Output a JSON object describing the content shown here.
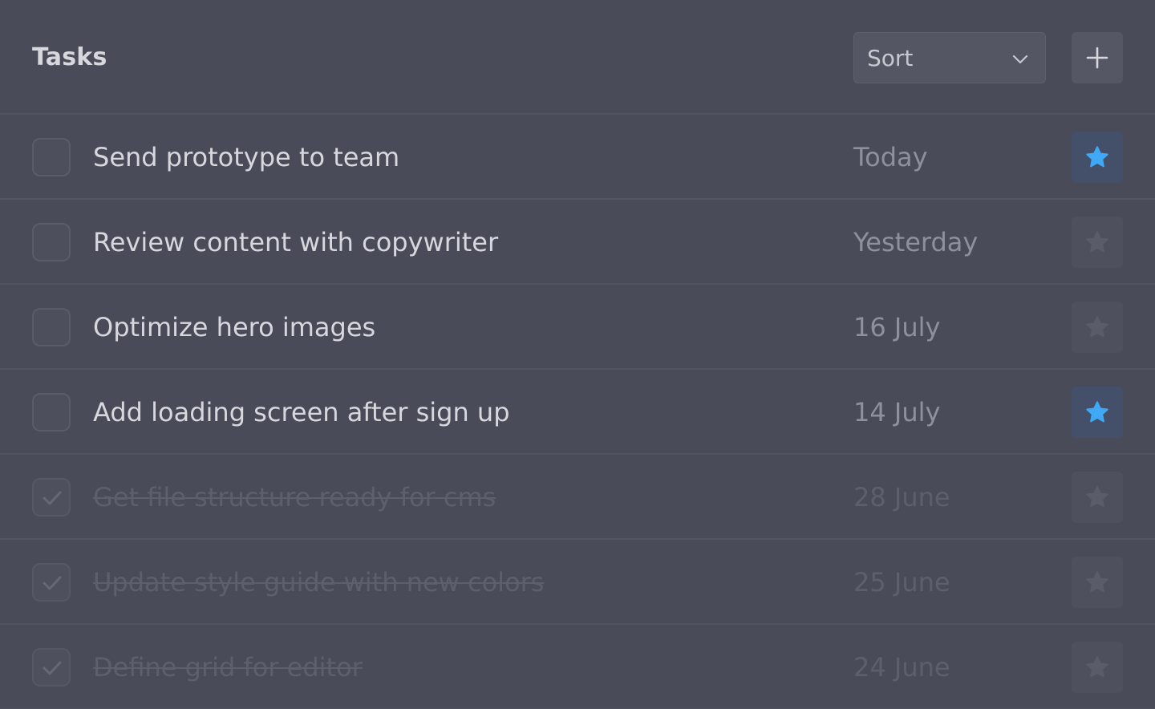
{
  "header": {
    "title": "Tasks",
    "sort_label": "Sort",
    "add_icon": "plus-icon",
    "sort_icon": "chevron-down-icon"
  },
  "colors": {
    "background": "#494b59",
    "star_active": "#3fa9f5",
    "star_inactive": "#5a5c69"
  },
  "tasks": [
    {
      "title": "Send prototype to team",
      "date": "Today",
      "done": false,
      "starred": true
    },
    {
      "title": "Review content with copywriter",
      "date": "Yesterday",
      "done": false,
      "starred": false
    },
    {
      "title": "Optimize hero images",
      "date": "16 July",
      "done": false,
      "starred": false
    },
    {
      "title": "Add loading screen after sign up",
      "date": "14 July",
      "done": false,
      "starred": true
    },
    {
      "title": "Get file structure ready for cms",
      "date": "28 June",
      "done": true,
      "starred": false
    },
    {
      "title": "Update style guide with new colors",
      "date": "25 June",
      "done": true,
      "starred": false
    },
    {
      "title": "Define grid for editor",
      "date": "24 June",
      "done": true,
      "starred": false
    }
  ]
}
